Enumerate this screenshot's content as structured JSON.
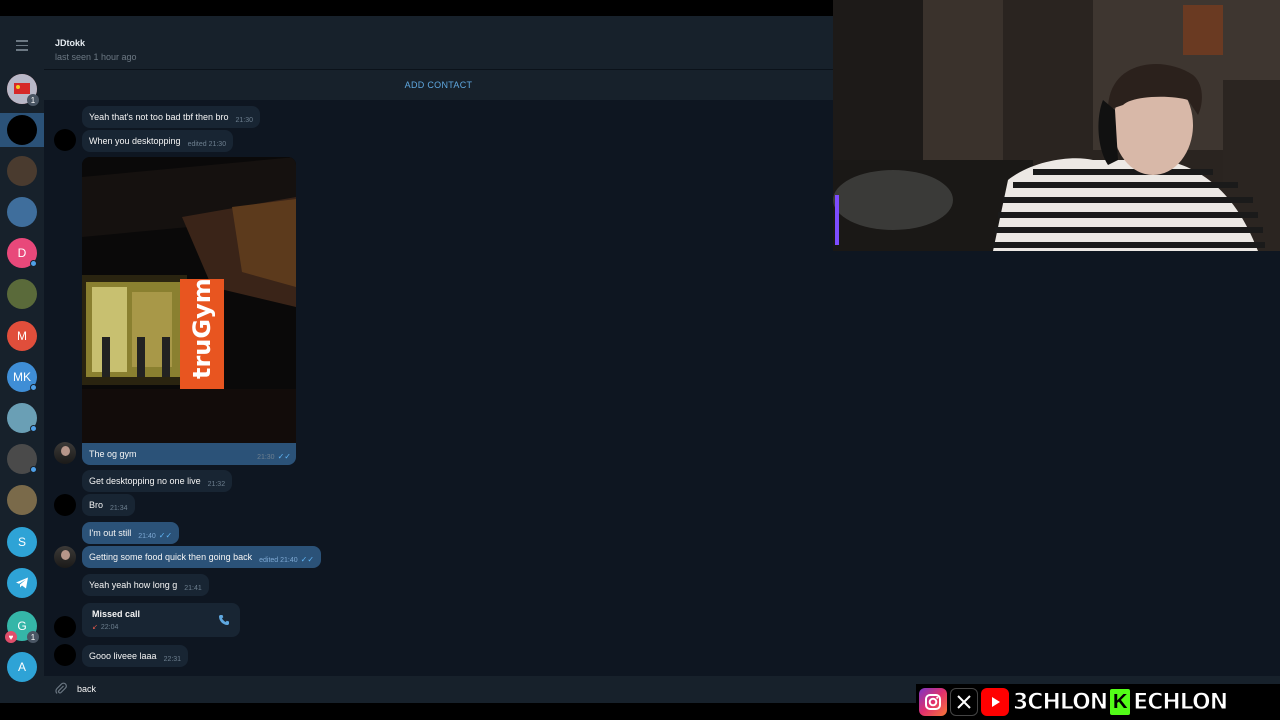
{
  "header": {
    "name": "JDtokk",
    "status": "last seen 1 hour ago",
    "add_contact": "ADD CONTACT"
  },
  "sidebar": {
    "avatars": [
      {
        "letter": "",
        "color": "#c0392b",
        "badge": "1"
      },
      {
        "letter": "",
        "color": "#000000",
        "active": true
      },
      {
        "letter": "",
        "color": "#4a3b2f"
      },
      {
        "letter": "",
        "color": "#3f6e9c"
      },
      {
        "letter": "D",
        "color": "#e8487a"
      },
      {
        "letter": "",
        "color": "#5a6a3a"
      },
      {
        "letter": "M",
        "color": "#e04e3b"
      },
      {
        "letter": "MK",
        "color": "#3f8ed6"
      },
      {
        "letter": "",
        "color": "#6a9fb5"
      },
      {
        "letter": "",
        "color": "#4a4a4a"
      },
      {
        "letter": "",
        "color": "#7a6a4a"
      },
      {
        "letter": "S",
        "color": "#2ea3d6"
      },
      {
        "letter": "",
        "color": "#2ea3d6"
      },
      {
        "letter": "G",
        "color": "#35b6a8",
        "badge": "1"
      },
      {
        "letter": "A",
        "color": "#2ea3d6"
      }
    ]
  },
  "messages": [
    {
      "text": "Yeah that's not too bad tbf then bro",
      "time": "21:30"
    },
    {
      "text": "When you desktopping",
      "time": "edited 21:30"
    },
    {
      "photo_sign": "truGym",
      "text": "The og gym",
      "time": "21:30",
      "checks": "✓✓"
    },
    {
      "text": "Get desktopping no one live",
      "time": "21:32"
    },
    {
      "text": "Bro",
      "time": "21:34"
    },
    {
      "text": "I'm out still",
      "time": "21:40",
      "checks": "✓✓"
    },
    {
      "text": "Getting some food quick then going back",
      "time": "edited 21:40",
      "checks": "✓✓"
    },
    {
      "text": "Yeah yeah how long g",
      "time": "21:41"
    },
    {
      "call_title": "Missed call",
      "call_arrow": "↙",
      "time": "22:04"
    },
    {
      "text": "Gooo liveee laaa",
      "time": "22:31"
    }
  ],
  "composer": {
    "value": "back"
  },
  "socials": {
    "instagram_icon": "instagram-icon",
    "x_icon": "x-icon",
    "youtube_icon": "youtube-icon",
    "brand_left": "3CHLON",
    "kick_letter": "K",
    "brand_right": "ECHLON"
  },
  "colors": {
    "bg": "#0e1621",
    "panel": "#17212b",
    "incoming": "#182533",
    "outgoing": "#2b5278",
    "accent": "#5fa8e0",
    "kick_green": "#53fc18"
  }
}
